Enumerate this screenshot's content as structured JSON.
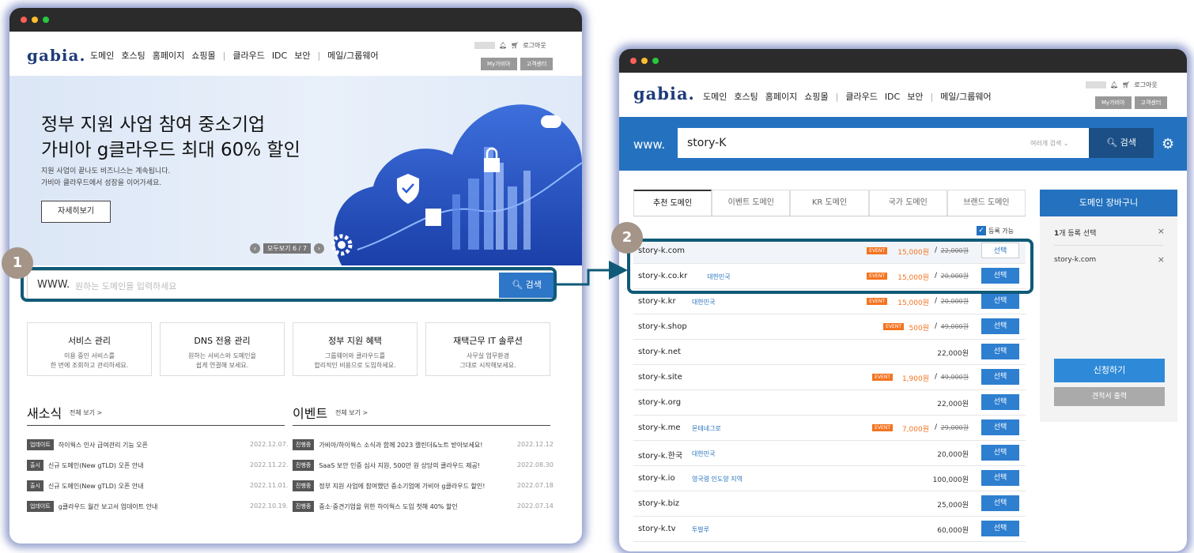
{
  "left": {
    "logo": "gabia.",
    "nav": [
      "도메인",
      "호스팅",
      "홈페이지",
      "쇼핑몰",
      "클라우드",
      "IDC",
      "보안",
      "메일/그룹웨어"
    ],
    "logout": "로그아웃",
    "my_gabia": "My가비아",
    "support": "고객센터",
    "banner": {
      "title1": "정부 지원 사업 참여 중소기업",
      "title2": "가비아 g클라우드 최대 60% 할인",
      "sub1": "지원 사업이 끝나도 비즈니스는 계속됩니다.",
      "sub2": "가비아 클라우드에서 성장을 이어가세요.",
      "button": "자세히보기",
      "pager": "모두보기 6 / 7"
    },
    "search": {
      "prefix": "WWW.",
      "placeholder": "원하는 도메인을 입력하세요",
      "button": "검색"
    },
    "cards": [
      {
        "title": "서비스 관리",
        "d1": "이용 중인 서비스를",
        "d2": "한 번에 조회하고 관리하세요."
      },
      {
        "title": "DNS 전용 관리",
        "d1": "원하는 서비스와 도메인을",
        "d2": "쉽게 연결해 보세요."
      },
      {
        "title": "정부 지원 혜택",
        "d1": "그룹웨어와 클라우드를",
        "d2": "합리적인 비용으로 도입하세요."
      },
      {
        "title": "재택근무 IT 솔루션",
        "d1": "사무실 업무환경",
        "d2": "그대로 시작해보세요."
      }
    ],
    "news": {
      "title": "새소식",
      "more": "전체 보기 >",
      "items": [
        {
          "tag": "업데이트",
          "text": "하이웍스 인사 급여관리 기능 오픈",
          "date": "2022.12.07."
        },
        {
          "tag": "출시",
          "text": "신규 도메인(New gTLD) 오픈 안내",
          "date": "2022.11.22."
        },
        {
          "tag": "출시",
          "text": "신규 도메인(New gTLD) 오픈 안내",
          "date": "2022.11.01."
        },
        {
          "tag": "업데이트",
          "text": "g클라우드 월간 보고서 업데이트 안내",
          "date": "2022.10.19."
        }
      ]
    },
    "events": {
      "title": "이벤트",
      "more": "전체 보기 >",
      "items": [
        {
          "tag": "진행중",
          "text": "가비아/하이웍스 소식과 함께 2023 캘린더&노트 받아보세요!",
          "date": "2022.12.12"
        },
        {
          "tag": "진행중",
          "text": "SaaS 보안 인증 심사 지원, 500만 원 상당의 클라우드 제공!",
          "date": "2022.08.30"
        },
        {
          "tag": "진행중",
          "text": "정부 지원 사업에 참여했던 중소기업에 가비아 g클라우드 할인!",
          "date": "2022.07.18"
        },
        {
          "tag": "진행중",
          "text": "중소·중견기업을 위한 하이웍스 도입 첫해 40% 할인",
          "date": "2022.07.14"
        }
      ]
    }
  },
  "right": {
    "logo": "gabia.",
    "nav": [
      "도메인",
      "호스팅",
      "홈페이지",
      "쇼핑몰",
      "클라우드",
      "IDC",
      "보안",
      "메일/그룹웨어"
    ],
    "logout": "로그아웃",
    "my_gabia": "My가비아",
    "support": "고객센터",
    "search": {
      "prefix": "www.",
      "value": "story-K",
      "multi": "여러개 검색 ⌄",
      "button": "검색"
    },
    "tabs": [
      "추천 도메인",
      "이벤트 도메인",
      "KR 도메인",
      "국가 도메인",
      "브랜드 도메인"
    ],
    "avail": "등록 가능",
    "domains": [
      {
        "name": "story-k.com",
        "country": "",
        "event": "EVENT",
        "price": "15,000원",
        "orig": "22,000원",
        "btn": "선택",
        "outline": true
      },
      {
        "name": "story-k.co.kr",
        "country": "대한민국",
        "event": "EVENT",
        "price": "15,000원",
        "orig": "20,000원",
        "btn": "선택",
        "outline": false
      },
      {
        "name": "story-k.kr",
        "country": "대한민국",
        "event": "EVENT",
        "price": "15,000원",
        "orig": "20,000원",
        "btn": "선택",
        "outline": false
      },
      {
        "name": "story-k.shop",
        "country": "",
        "event": "EVENT",
        "price": "500원",
        "orig": "49,000원",
        "btn": "선택",
        "outline": false
      },
      {
        "name": "story-k.net",
        "country": "",
        "event": "",
        "price": "22,000원",
        "orig": "",
        "btn": "선택",
        "outline": false
      },
      {
        "name": "story-k.site",
        "country": "",
        "event": "EVENT",
        "price": "1,900원",
        "orig": "49,000원",
        "btn": "선택",
        "outline": false
      },
      {
        "name": "story-k.org",
        "country": "",
        "event": "",
        "price": "22,000원",
        "orig": "",
        "btn": "선택",
        "outline": false
      },
      {
        "name": "story-k.me",
        "country": "몬테네그로",
        "event": "EVENT",
        "price": "7,000원",
        "orig": "29,000원",
        "btn": "선택",
        "outline": false
      },
      {
        "name": "story-k.한국",
        "country": "대한민국",
        "event": "",
        "price": "20,000원",
        "orig": "",
        "btn": "선택",
        "outline": false
      },
      {
        "name": "story-k.io",
        "country": "영국령 인도양 지역",
        "event": "",
        "price": "100,000원",
        "orig": "",
        "btn": "선택",
        "outline": false
      },
      {
        "name": "story-k.biz",
        "country": "",
        "event": "",
        "price": "25,000원",
        "orig": "",
        "btn": "선택",
        "outline": false
      },
      {
        "name": "story-k.tv",
        "country": "투발루",
        "event": "",
        "price": "60,000원",
        "orig": "",
        "btn": "선택",
        "outline": false
      }
    ],
    "cart": {
      "title": "도메인 장바구니",
      "count_num": "1",
      "count_text": "개 등록 선택",
      "item": "story-k.com",
      "apply": "신청하기",
      "quote": "견적서 출력"
    }
  },
  "markers": [
    "1",
    "2"
  ],
  "colors": {
    "brand_blue": "#2472bf",
    "event_orange": "#f47421",
    "highlight": "#0f5a78",
    "marker": "#a49588"
  }
}
